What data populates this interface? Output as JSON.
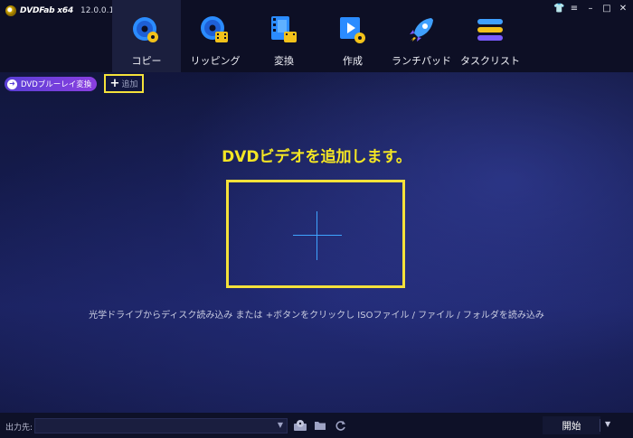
{
  "app": {
    "brand_name": "DVDFab x64",
    "version": "12.0.0.1"
  },
  "window_controls": [
    {
      "icon": "skin-icon",
      "glyph": "👕"
    },
    {
      "icon": "menu-icon",
      "glyph": "≡"
    },
    {
      "icon": "minimize-icon",
      "glyph": "–"
    },
    {
      "icon": "maximize-icon",
      "glyph": "□"
    },
    {
      "icon": "close-icon",
      "glyph": "✕"
    }
  ],
  "nav": {
    "items": [
      {
        "label": "コピー",
        "icon": "copy-disc-icon",
        "active": true
      },
      {
        "label": "リッピング",
        "icon": "ripper-disc-icon",
        "active": false
      },
      {
        "label": "変換",
        "icon": "converter-film-icon",
        "active": false
      },
      {
        "label": "作成",
        "icon": "creator-video-icon",
        "active": false
      },
      {
        "label": "ランチパッド",
        "icon": "launchpad-rocket-icon",
        "active": false
      },
      {
        "label": "タスクリスト",
        "icon": "tasklist-stack-icon",
        "active": false
      }
    ]
  },
  "toolbar": {
    "mode_label": "DVDブルーレイ変換",
    "add_label": "追加"
  },
  "main": {
    "headline": "DVDビデオを追加します。",
    "hint": "光学ドライブからディスク読み込み または +ボタンをクリックし ISOファイル / ファイル / フォルダを読み込み"
  },
  "bottom": {
    "output_label": "出力先:",
    "output_value": "",
    "start_label": "開始"
  },
  "colors": {
    "accent_yellow": "#f4e13a",
    "headline_yellow": "#f4e624",
    "crosshair_blue": "#3fa4ff",
    "mode_pill_purple": "#6a3fd9"
  }
}
